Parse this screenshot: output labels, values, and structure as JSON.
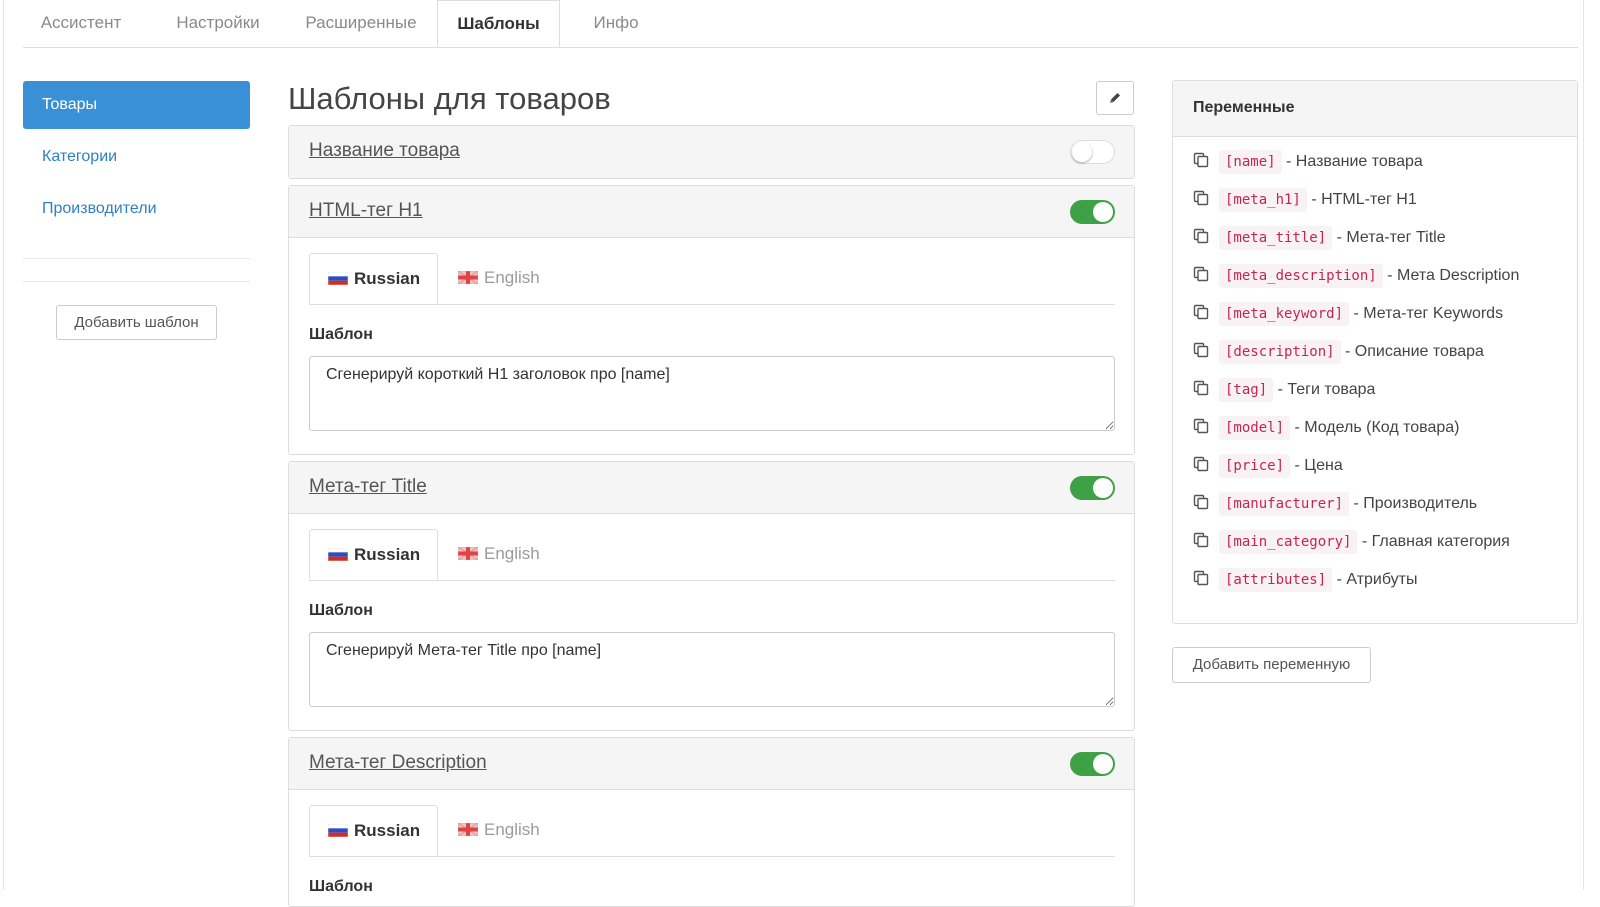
{
  "top_tabs": [
    {
      "label": "Ассистент",
      "active": false
    },
    {
      "label": "Настройки",
      "active": false
    },
    {
      "label": "Расширенные",
      "active": false
    },
    {
      "label": "Шаблоны",
      "active": true
    },
    {
      "label": "Инфо",
      "active": false
    }
  ],
  "sidebar": {
    "items": [
      {
        "label": "Товары",
        "active": true
      },
      {
        "label": "Категории",
        "active": false
      },
      {
        "label": "Производители",
        "active": false
      }
    ],
    "add_template_label": "Добавить шаблон"
  },
  "main": {
    "title": "Шаблоны для товаров",
    "edit_icon": "pencil-icon",
    "panels": [
      {
        "title": "Название товара",
        "enabled": false
      },
      {
        "title": "HTML-тег H1",
        "enabled": true,
        "lang_tabs": [
          "Russian",
          "English"
        ],
        "active_lang": "Russian",
        "field_label": "Шаблон",
        "template_value": "Сгенерируй короткий H1 заголовок про [name]"
      },
      {
        "title": "Мета-тег Title",
        "enabled": true,
        "lang_tabs": [
          "Russian",
          "English"
        ],
        "active_lang": "Russian",
        "field_label": "Шаблон",
        "template_value": "Сгенерируй Мета-тег Title про [name]"
      },
      {
        "title": "Мета-тег Description",
        "enabled": true,
        "lang_tabs": [
          "Russian",
          "English"
        ],
        "active_lang": "Russian",
        "field_label": "Шаблон",
        "template_value": ""
      }
    ]
  },
  "variables": {
    "title": "Переменные",
    "copy_icon": "copy-icon",
    "items": [
      {
        "code": "[name]",
        "desc": "- Название товара"
      },
      {
        "code": "[meta_h1]",
        "desc": "- HTML-тег H1"
      },
      {
        "code": "[meta_title]",
        "desc": "- Мета-тег Title"
      },
      {
        "code": "[meta_description]",
        "desc": "- Мета Description"
      },
      {
        "code": "[meta_keyword]",
        "desc": "- Мета-тег Keywords"
      },
      {
        "code": "[description]",
        "desc": "- Описание товара"
      },
      {
        "code": "[tag]",
        "desc": "- Теги товара"
      },
      {
        "code": "[model]",
        "desc": "- Модель (Код товара)"
      },
      {
        "code": "[price]",
        "desc": "- Цена"
      },
      {
        "code": "[manufacturer]",
        "desc": "- Производитель"
      },
      {
        "code": "[main_category]",
        "desc": "- Главная категория"
      },
      {
        "code": "[attributes]",
        "desc": "- Атрибуты"
      }
    ],
    "add_variable_label": "Добавить переменную"
  },
  "colors": {
    "accent": "#3990d6",
    "toggle_on": "#3fa146",
    "code_text": "#c7254e",
    "code_bg": "#f9f2f4"
  }
}
